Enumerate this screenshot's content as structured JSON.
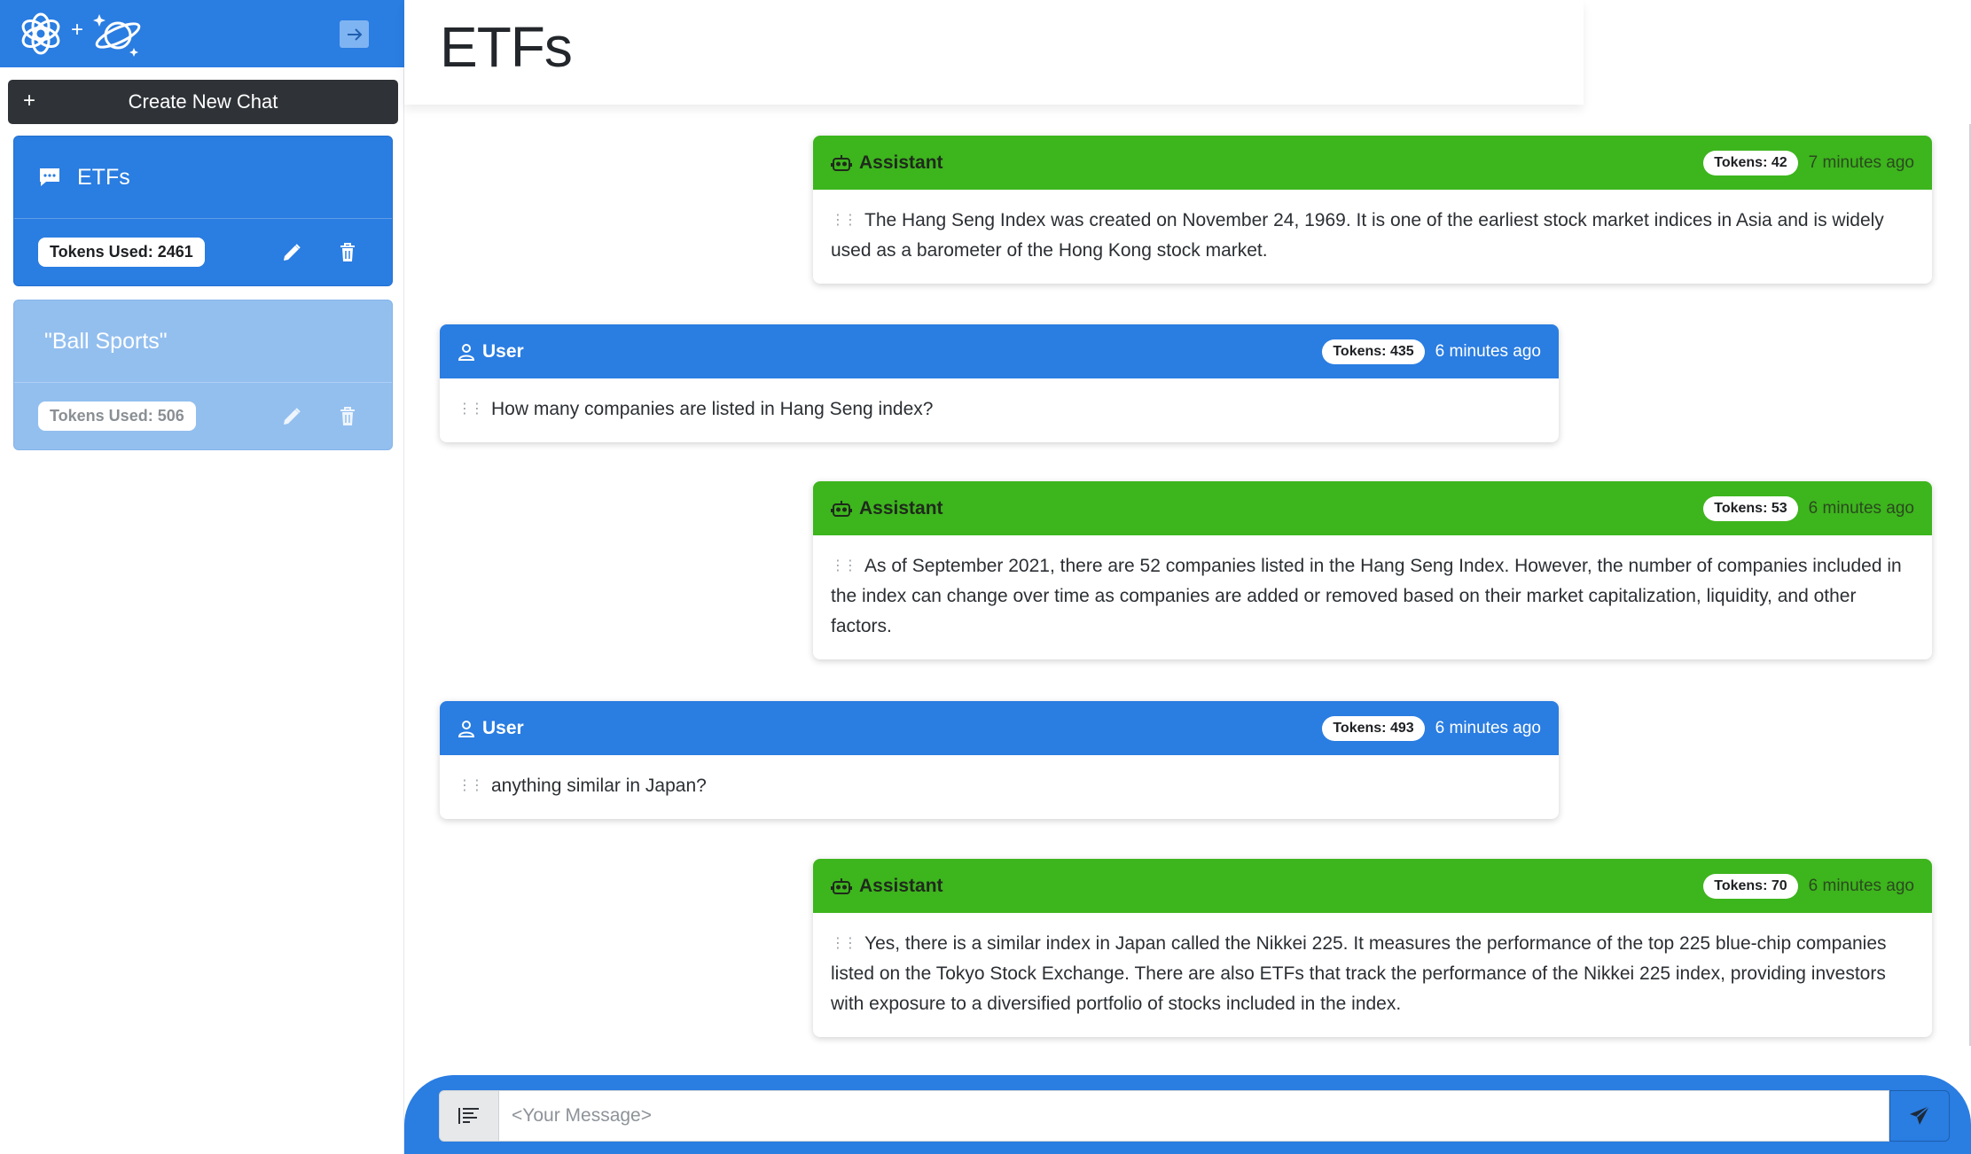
{
  "sidebar": {
    "logo_plus": "+",
    "new_chat": {
      "icon": "+",
      "label": "Create New Chat"
    },
    "chats": [
      {
        "title": "ETFs",
        "tokens": "Tokens Used: 2461",
        "active": true
      },
      {
        "title": "\"Ball Sports\"",
        "tokens": "Tokens Used: 506",
        "active": false
      }
    ]
  },
  "main": {
    "title": "ETFs",
    "messages": [
      {
        "role": "Assistant",
        "tokens": "Tokens: 42",
        "time": "7 minutes ago",
        "text": "The Hang Seng Index was created on November 24, 1969. It is one of the earliest stock market indices in Asia and is widely used as a barometer of the Hong Kong stock market."
      },
      {
        "role": "User",
        "tokens": "Tokens: 435",
        "time": "6 minutes ago",
        "text": "How many companies are listed in Hang Seng index?"
      },
      {
        "role": "Assistant",
        "tokens": "Tokens: 53",
        "time": "6 minutes ago",
        "text": "As of September 2021, there are 52 companies listed in the Hang Seng Index. However, the number of companies included in the index can change over time as companies are added or removed based on their market capitalization, liquidity, and other factors."
      },
      {
        "role": "User",
        "tokens": "Tokens: 493",
        "time": "6 minutes ago",
        "text": "anything similar in Japan?"
      },
      {
        "role": "Assistant",
        "tokens": "Tokens: 70",
        "time": "6 minutes ago",
        "text": "Yes, there is a similar index in Japan called the Nikkei 225. It measures the performance of the top 225 blue-chip companies listed on the Tokyo Stock Exchange. There are also ETFs that track the performance of the Nikkei 225 index, providing investors with exposure to a diversified portfolio of stocks included in the index."
      }
    ]
  },
  "composer": {
    "placeholder": "<Your Message>",
    "value": ""
  },
  "colors": {
    "primary": "#2a7de1",
    "assistant": "#3db51d",
    "dark_button": "#2f3337"
  },
  "icons": {
    "openai_logo": "openai-logo-icon",
    "planet_logo": "planet-logo-icon",
    "collapse": "arrow-right-icon",
    "chat": "chat-bubble-icon",
    "edit": "pencil-icon",
    "delete": "trash-icon",
    "assistant": "robot-icon",
    "user": "person-icon",
    "grip": "grip-icon",
    "format": "text-format-icon",
    "send": "send-icon"
  }
}
